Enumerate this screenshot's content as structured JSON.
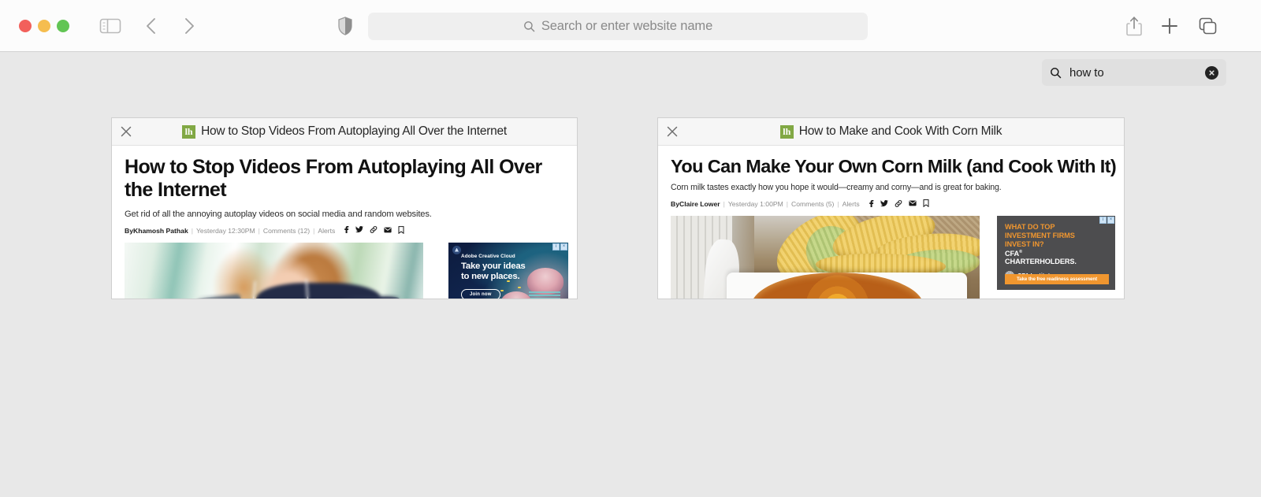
{
  "browser": {
    "window_controls": [
      "close",
      "minimize",
      "maximize"
    ],
    "sidebar_icon": "sidebar-icon",
    "back_icon": "chevron-left-icon",
    "forward_icon": "chevron-right-icon",
    "shield_icon": "privacy-shield-icon",
    "address_bar": {
      "placeholder": "Search or enter website name",
      "value": "",
      "search_icon": "search-icon"
    },
    "share_icon": "share-icon",
    "new_tab_icon": "plus-icon",
    "tab_overview_icon": "tabs-icon"
  },
  "find_bar": {
    "search_icon": "search-icon",
    "query": "how to",
    "clear_icon": "clear-circle-icon",
    "clear_glyph": "×"
  },
  "cards": [
    {
      "close_icon": "close-icon",
      "site_logo": "lifehacker-logo",
      "site_logo_text": "lh",
      "header_title": "How to Stop Videos From Autoplaying All Over the Internet",
      "headline": "How to Stop Videos From Autoplaying All Over the Internet",
      "dek": "Get rid of all the annoying autoplay videos on social media and random websites.",
      "byline": {
        "author_prefix": "By ",
        "author": "Khamosh Pathak",
        "timestamp": "Yesterday 12:30PM",
        "comments": "Comments (12)",
        "alerts": "Alerts",
        "social_icons": [
          "facebook-icon",
          "twitter-icon",
          "link-icon",
          "email-icon",
          "bookmark-icon"
        ]
      },
      "hero_image": "woman-looking-at-phone-photo",
      "ad": {
        "type": "adobe",
        "badge_icon": "adobe-badge-icon",
        "brand": "Adobe Creative Cloud",
        "headline_line1": "Take your ideas",
        "headline_line2": "to new places.",
        "cta": "Join now",
        "adchoices_icon": "adchoices-icon",
        "adchoices_close_icon": "ad-close-icon",
        "adchoices_glyphs": [
          "i",
          "×"
        ],
        "bg_color": "#0d1b3e"
      }
    },
    {
      "close_icon": "close-icon",
      "site_logo": "lifehacker-logo",
      "site_logo_text": "lh",
      "header_title": "How to Make and Cook With Corn Milk",
      "headline": "You Can Make Your Own Corn Milk (and Cook With It)",
      "dek": "Corn milk tastes exactly how you hope it would—creamy and corny—and is great for baking.",
      "byline": {
        "author_prefix": "By ",
        "author": "Claire Lower",
        "timestamp": "Yesterday 1:00PM",
        "comments": "Comments (5)",
        "alerts": "Alerts",
        "social_icons": [
          "facebook-icon",
          "twitter-icon",
          "link-icon",
          "email-icon",
          "bookmark-icon"
        ]
      },
      "hero_image": "corn-cobs-and-cornbread-photo",
      "ad": {
        "type": "cfa",
        "headline_line1": "WHAT DO TOP",
        "headline_line2": "INVESTMENT FIRMS",
        "headline_line3": "INVEST IN?",
        "subhead_line1": "CFA",
        "subhead_sup": "®",
        "subhead_line2": "CHARTERHOLDERS.",
        "institute": "CFA Institute",
        "institute_logo": "cfa-institute-logo",
        "cta": "Take the free readiness assessment",
        "adchoices_icon": "adchoices-icon",
        "adchoices_close_icon": "ad-close-icon",
        "adchoices_glyphs": [
          "i",
          "×"
        ],
        "bg_color": "#4d4d4f",
        "accent_color": "#f0962f"
      }
    }
  ],
  "colors": {
    "toolbar_bg": "#fcfcfc",
    "page_bg": "#e8e8e8",
    "lifehacker_green": "#81a844",
    "traffic_red": "#f2605b",
    "traffic_yellow": "#f5bd4f",
    "traffic_green": "#62c554"
  }
}
